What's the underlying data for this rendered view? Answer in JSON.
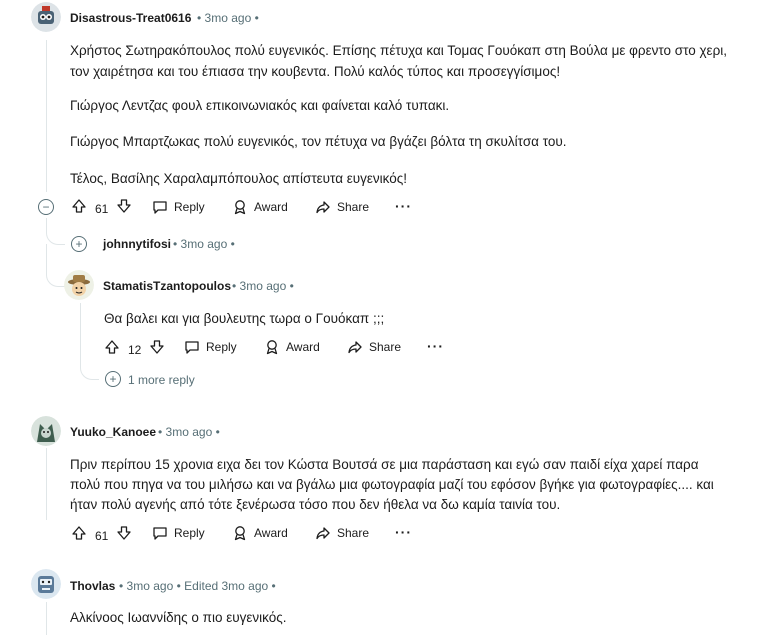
{
  "comments": {
    "c1": {
      "username": "Disastrous-Treat0616",
      "time": "3mo ago",
      "paragraphs": [
        "Χρήστος Σωτηρακόπουλος πολύ ευγενικός. Επίσης πέτυχα και Τομας Γουόκαπ στη Βούλα με φρεντο στο χερι,",
        "τον χαιρέτησα και του έπιασα την κουβεντα. Πολύ καλός τύπος και προσεγγίσιμος!",
        "Γιώργος Λεντζας φουλ επικοινωνιακός και φαίνεται καλό τυπακι.",
        "Γιώργος Μπαρτζωκας πολύ ευγενικός, τον πέτυχα να βγάζει βόλτα τη σκυλίτσα του.",
        "Τέλος, Βασίλης Χαραλαμπόπουλος απίστευτα ευγενικός!"
      ],
      "votes": "61",
      "reply": "Reply",
      "award": "Award",
      "share": "Share",
      "more": "···"
    },
    "c2": {
      "username": "johnnytifosi",
      "time": "3mo ago"
    },
    "c3": {
      "username": "StamatisTzantopoulos",
      "time": "3mo ago",
      "text": "Θα βαλει και για βουλευτης τωρα ο Γουόκαπ ;;;",
      "votes": "12",
      "reply": "Reply",
      "award": "Award",
      "share": "Share",
      "more": "···",
      "more_replies": "1 more reply"
    },
    "c4": {
      "username": "Yuuko_Kanoee",
      "time": "3mo ago",
      "lines": [
        "Πριν περίπου 15 χρονια ειχα δει τον Κώστα Βουτσά σε μια παράσταση και εγώ σαν παιδί είχα χαρεί παρα",
        "πολύ που πηγα να του μιλήσω και να βγάλω μια φωτογραφία μαζί του εφόσον βγήκε για φωτογραφίες.... και",
        "ήταν πολύ αγενής από τότε ξενέρωσα τόσο που δεν ήθελα να δω καμία ταινία του."
      ],
      "votes": "61",
      "reply": "Reply",
      "award": "Award",
      "share": "Share",
      "more": "···"
    },
    "c5": {
      "username": "Thovlas",
      "time": "3mo ago",
      "edited": "Edited 3mo ago",
      "text": "Αλκίνοος Ιωαννίδης ο πιο ευγενικός."
    }
  },
  "separator": "•",
  "colors": {
    "meta": "#576f76",
    "text": "#1c1c1c",
    "thread_line": "#e0e6e8"
  },
  "icons": [
    "upvote-icon",
    "downvote-icon",
    "reply-icon",
    "award-icon",
    "share-icon",
    "collapse-icon",
    "expand-icon"
  ]
}
